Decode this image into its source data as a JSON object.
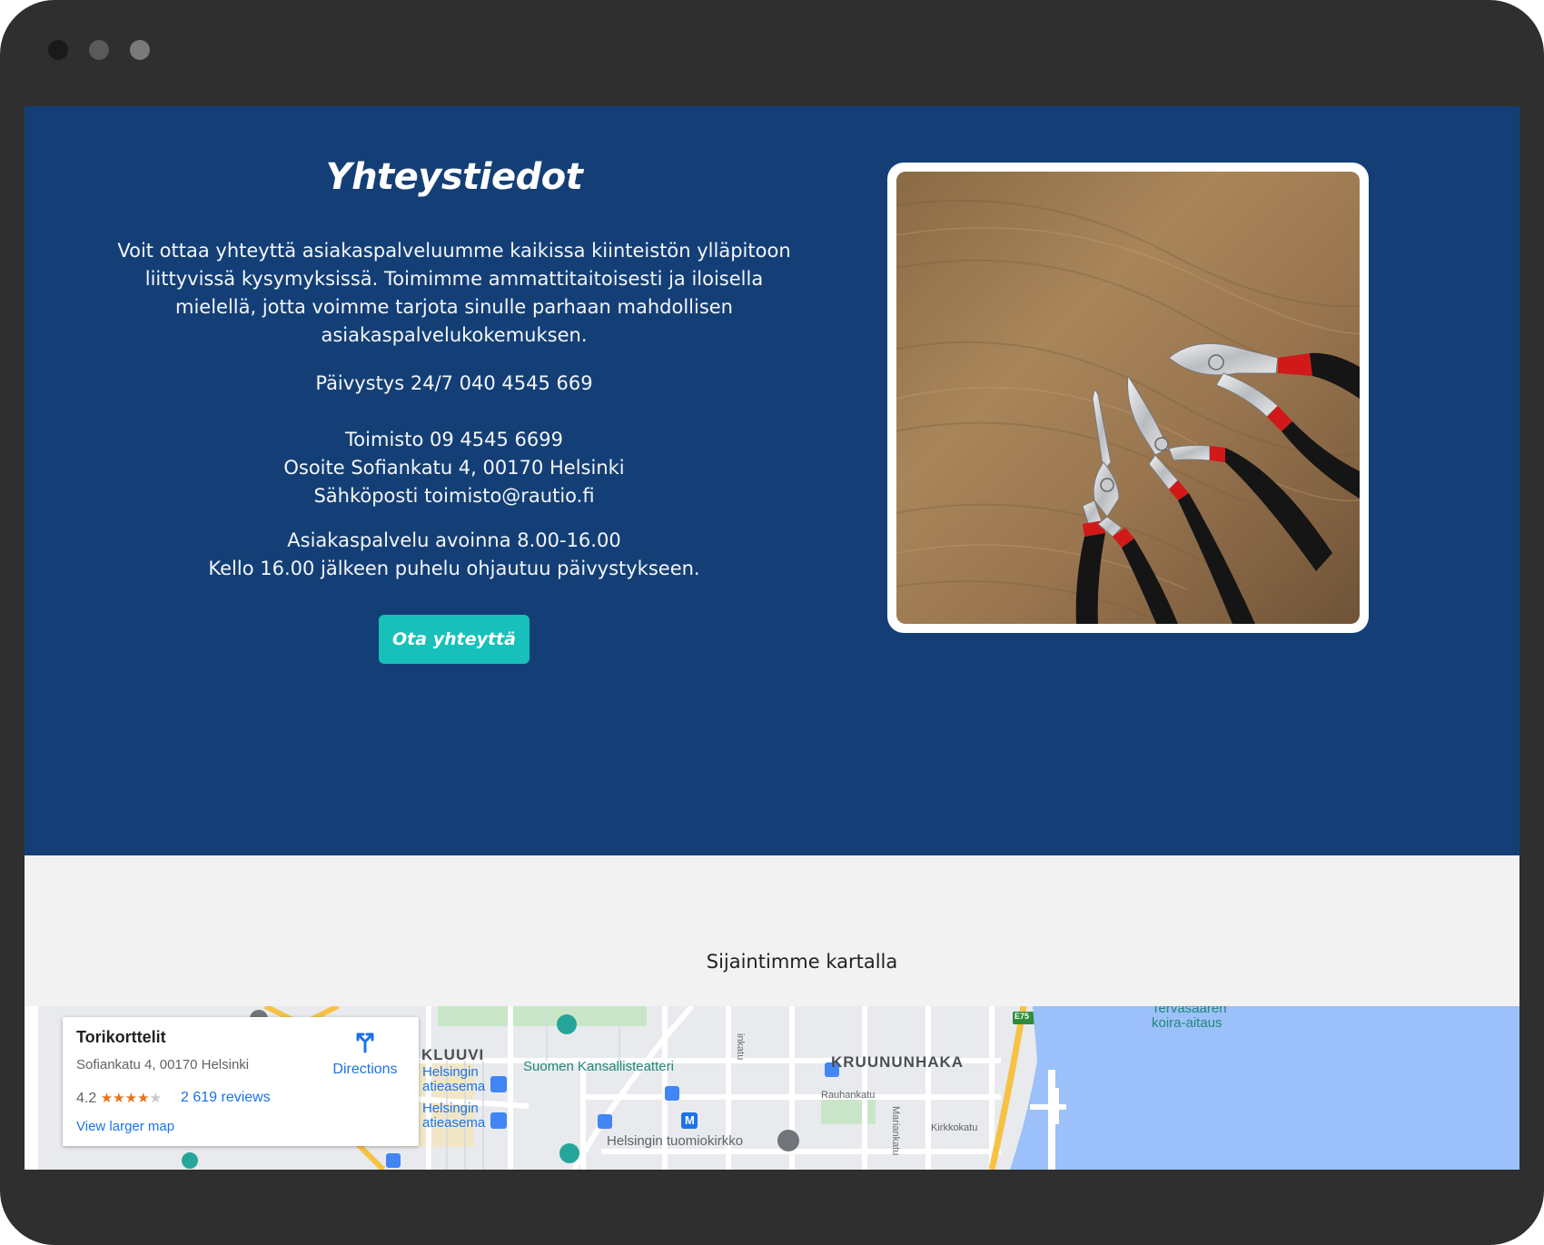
{
  "window": {
    "controls": [
      "close",
      "minimize",
      "maximize"
    ]
  },
  "hero": {
    "title": "Yhteystiedot",
    "description": "Voit ottaa yhteyttä asiakaspalveluumme kaikissa kiinteistön ylläpitoon liittyvissä kysymyksissä. Toimimme ammattitaitoisesti ja iloisella mielellä, jotta voimme tarjota sinulle parhaan mahdollisen asiakaspalvelukokemuksen.",
    "emergency": "Päivystys 24/7 040 4545 669",
    "office_phone": "Toimisto 09 4545 6699",
    "address": "Osoite Sofiankatu 4, 00170 Helsinki",
    "email": "Sähköposti toimisto@rautio.fi",
    "hours": "Asiakaspalvelu avoinna 8.00-16.00",
    "after_hours": "Kello 16.00 jälkeen puhelu ohjautuu päivystykseen.",
    "cta_label": "Ota yhteyttä",
    "image_icon": "pliers-photo"
  },
  "map_section": {
    "heading": "Sijaintimme kartalla",
    "card": {
      "place_name": "Torikorttelit",
      "address": "Sofiankatu 4, 00170 Helsinki",
      "rating": "4.2",
      "rating_value": 4.2,
      "reviews": "2 619 reviews",
      "directions_label": "Directions",
      "larger_map": "View larger map"
    },
    "labels": {
      "kluuvi": "KLUUVI",
      "kansallisteatteri": "Suomen Kansallisteatteri",
      "kruununhaka": "KRUUNUNHAKA",
      "tervasaaren": "Tervasaaren",
      "koira_aitaus": "koira-aitaus",
      "helsingin_1": "Helsingin",
      "rautatieasema_1": "atieasema",
      "helsingin_2": "Helsingin",
      "rautatieasema_2": "atieasema",
      "rauhankatu": "Rauhankatu",
      "kirkkokatu": "Kirkkokatu",
      "mariankatu": "Mariankatu",
      "tuomiokirkko": "Helsingin tuomiokirkko",
      "e75": "E75",
      "metro": "M"
    },
    "colors": {
      "water": "#9cc0f9",
      "land": "#e8eaed",
      "park": "#c9e7c8",
      "highway": "#f7c244"
    }
  },
  "colors": {
    "hero_bg": "#143f76",
    "cta_bg": "#17c0bb",
    "section_bg": "#f2f2f2",
    "frame": "#2f2f2f"
  }
}
